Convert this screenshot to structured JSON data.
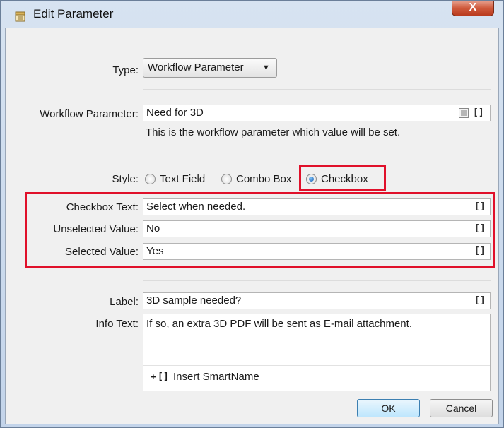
{
  "window": {
    "title": "Edit Parameter",
    "close_glyph": "X"
  },
  "type": {
    "label": "Type:",
    "value": "Workflow Parameter",
    "arrow": "▼"
  },
  "workflow_parameter": {
    "label": "Workflow Parameter:",
    "value": "Need for 3D",
    "hint": "This is the workflow parameter which value will be set."
  },
  "style": {
    "label": "Style:",
    "options": [
      {
        "label": "Text Field",
        "selected": false
      },
      {
        "label": "Combo Box",
        "selected": false
      },
      {
        "label": "Checkbox",
        "selected": true
      }
    ]
  },
  "checkbox_text": {
    "label": "Checkbox Text:",
    "value": "Select when needed."
  },
  "unselected_value": {
    "label": "Unselected Value:",
    "value": "No"
  },
  "selected_value": {
    "label": "Selected Value:",
    "value": "Yes"
  },
  "label_field": {
    "label": "Label:",
    "value": "3D sample needed?"
  },
  "info_text": {
    "label": "Info Text:",
    "value": "If so, an extra 3D PDF will be sent as E-mail attachment.",
    "insert_smartname": "Insert SmartName"
  },
  "smartname_glyph": "[]",
  "buttons": {
    "ok": "OK",
    "cancel": "Cancel"
  },
  "colors": {
    "highlight": "#e0102a",
    "close_button": "#cf5a3c"
  }
}
